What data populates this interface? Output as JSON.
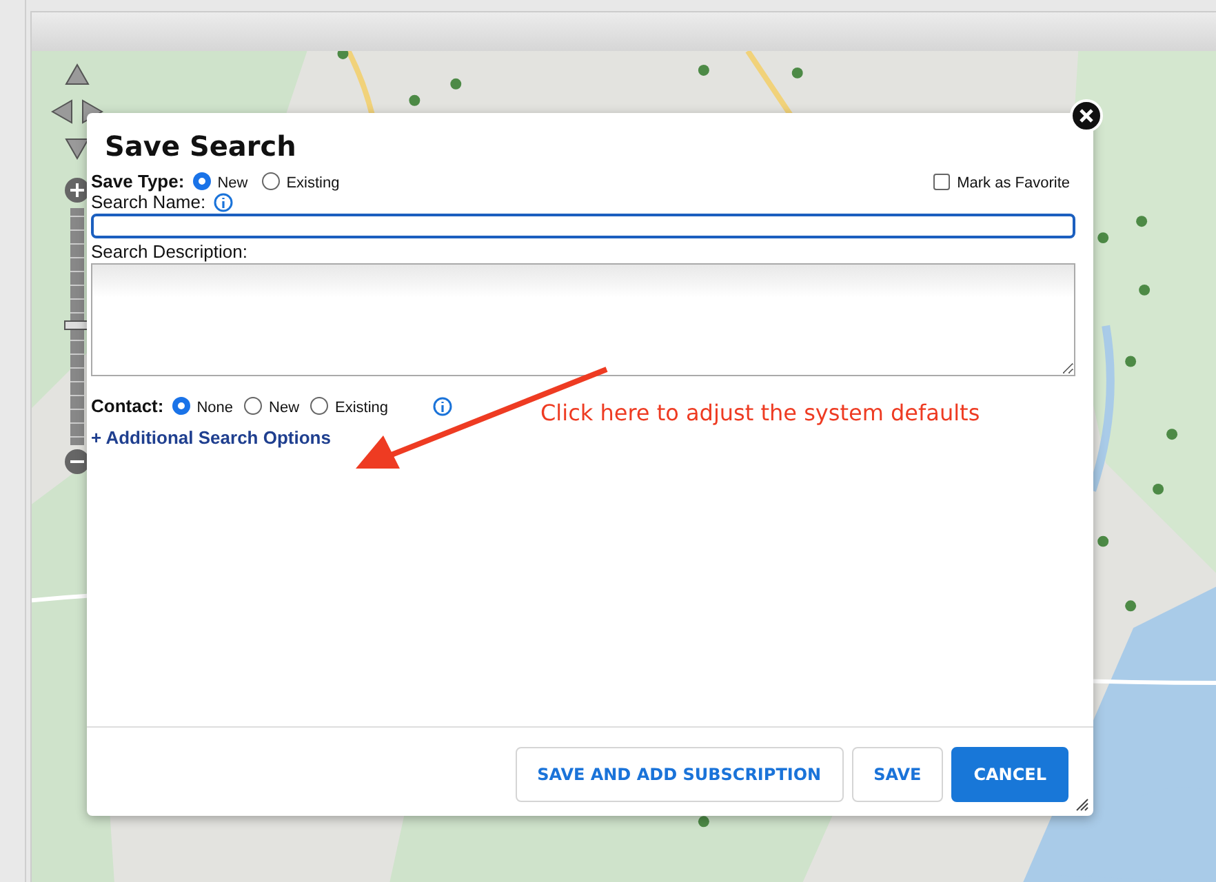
{
  "dialog": {
    "title": "Save Search",
    "save_type": {
      "label": "Save Type:",
      "options": [
        {
          "label": "New",
          "selected": true
        },
        {
          "label": "Existing",
          "selected": false
        }
      ]
    },
    "favorite": {
      "label": "Mark as Favorite",
      "checked": false
    },
    "search_name": {
      "label": "Search Name:"
    },
    "search_description": {
      "label": "Search Description:"
    },
    "contact": {
      "label": "Contact:",
      "options": [
        {
          "label": "None",
          "selected": true
        },
        {
          "label": "New",
          "selected": false
        },
        {
          "label": "Existing",
          "selected": false
        }
      ]
    },
    "link": "+ Additional Search Options",
    "buttons": [
      {
        "label": "SAVE AND ADD SUBSCRIPTION",
        "kind": "secondary"
      },
      {
        "label": "SAVE",
        "kind": "secondary"
      },
      {
        "label": "CANCEL",
        "kind": "primary"
      }
    ]
  },
  "annotation": {
    "text": "Click here to adjust the system defaults"
  }
}
